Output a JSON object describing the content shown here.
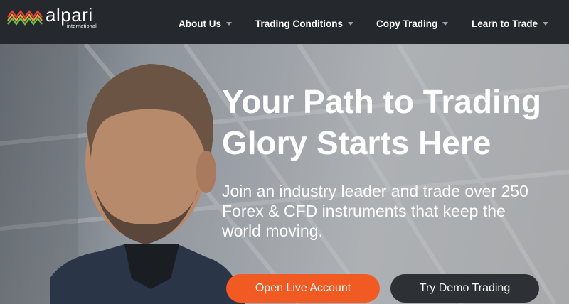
{
  "brand": {
    "name": "alpari",
    "subtitle": "international",
    "logo_icon": "alpari-waves-logo-icon",
    "colors": {
      "wave_top": "#e8403a",
      "wave_mid": "#f1a33a",
      "wave_bottom": "#6ec04a"
    }
  },
  "nav": {
    "items": [
      {
        "label": "About Us",
        "icon": "chevron-down-icon"
      },
      {
        "label": "Trading Conditions",
        "icon": "chevron-down-icon"
      },
      {
        "label": "Copy Trading",
        "icon": "chevron-down-icon"
      },
      {
        "label": "Learn to Trade",
        "icon": "chevron-down-icon"
      }
    ]
  },
  "hero": {
    "headline_line1": "Your Path to Trading",
    "headline_line2": "Glory Starts Here",
    "subtext_line1": "Join an industry leader and trade over 250",
    "subtext_line2": "Forex & CFD instruments that keep the",
    "subtext_line3": "world moving.",
    "primary_cta": "Open Live Account",
    "secondary_cta": "Try Demo Trading"
  },
  "colors": {
    "header_bg": "#25282d",
    "accent": "#f15a22",
    "secondary_button": "#2d3035"
  }
}
